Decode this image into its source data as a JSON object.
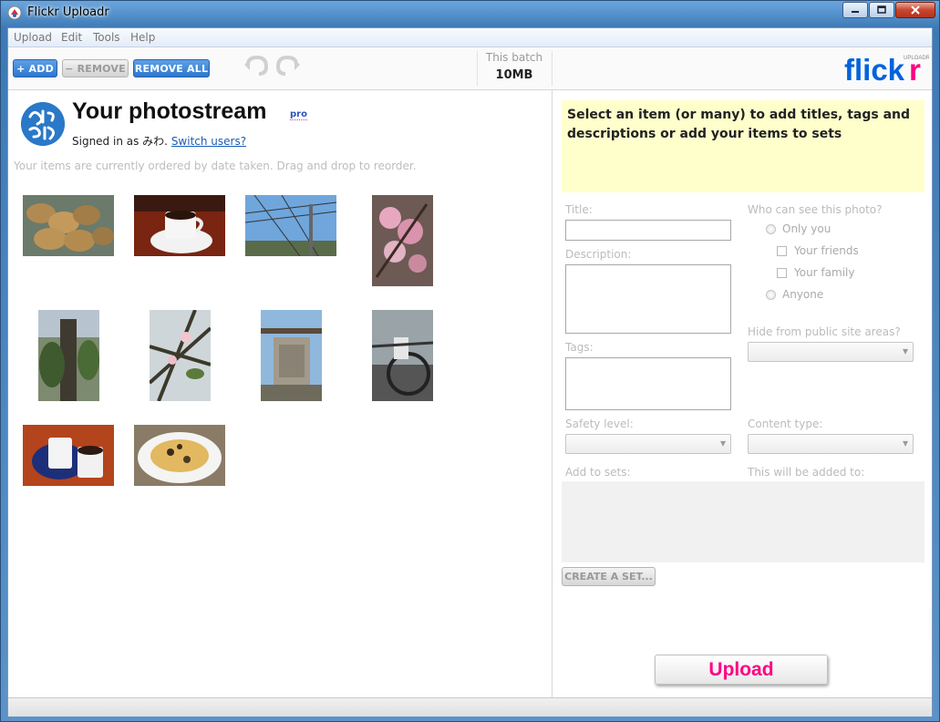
{
  "window": {
    "title": "Flickr Uploadr"
  },
  "menu": [
    {
      "label": "Upload"
    },
    {
      "label": "Edit"
    },
    {
      "label": "Tools"
    },
    {
      "label": "Help"
    }
  ],
  "toolbar": {
    "add_label": "+ ADD",
    "remove_label": "− REMOVE",
    "remove_all_label": "REMOVE ALL",
    "batch_label": "This batch",
    "batch_value": "10MB"
  },
  "logo": {
    "text": "flickr",
    "subtext": "UPLOADR"
  },
  "photostream": {
    "title": "Your photostream",
    "badge": "pro",
    "signed_in_prefix": "Signed in as みわ.",
    "switch_users": "Switch users?",
    "order_hint": "Your items are currently ordered by date taken. Drag and drop to reorder."
  },
  "photos": [
    {
      "subject": "cookies on plate"
    },
    {
      "subject": "coffee cup"
    },
    {
      "subject": "power lines and sky"
    },
    {
      "subject": "cherry blossoms"
    },
    {
      "subject": "tree trunk"
    },
    {
      "subject": "blossom branch"
    },
    {
      "subject": "stone monument"
    },
    {
      "subject": "bicycle"
    },
    {
      "subject": "coffee mugs"
    },
    {
      "subject": "spaghetti"
    }
  ],
  "form": {
    "help_text": "Select an item (or many) to add titles, tags and descriptions or add your items to sets",
    "title_label": "Title:",
    "description_label": "Description:",
    "tags_label": "Tags:",
    "visibility_label": "Who can see this photo?",
    "only_you": "Only you",
    "your_friends": "Your friends",
    "your_family": "Your family",
    "anyone": "Anyone",
    "hide_label": "Hide from public site areas?",
    "safety_label": "Safety level:",
    "content_type_label": "Content type:",
    "add_to_sets_label": "Add to sets:",
    "added_to_label": "This will be added to:",
    "create_set": "CREATE A SET...",
    "upload": "Upload"
  },
  "colors": {
    "accent_blue": "#2d77cf",
    "flickr_blue": "#0063dc",
    "flickr_pink": "#ff0084",
    "help_bg": "#ffffcc"
  }
}
